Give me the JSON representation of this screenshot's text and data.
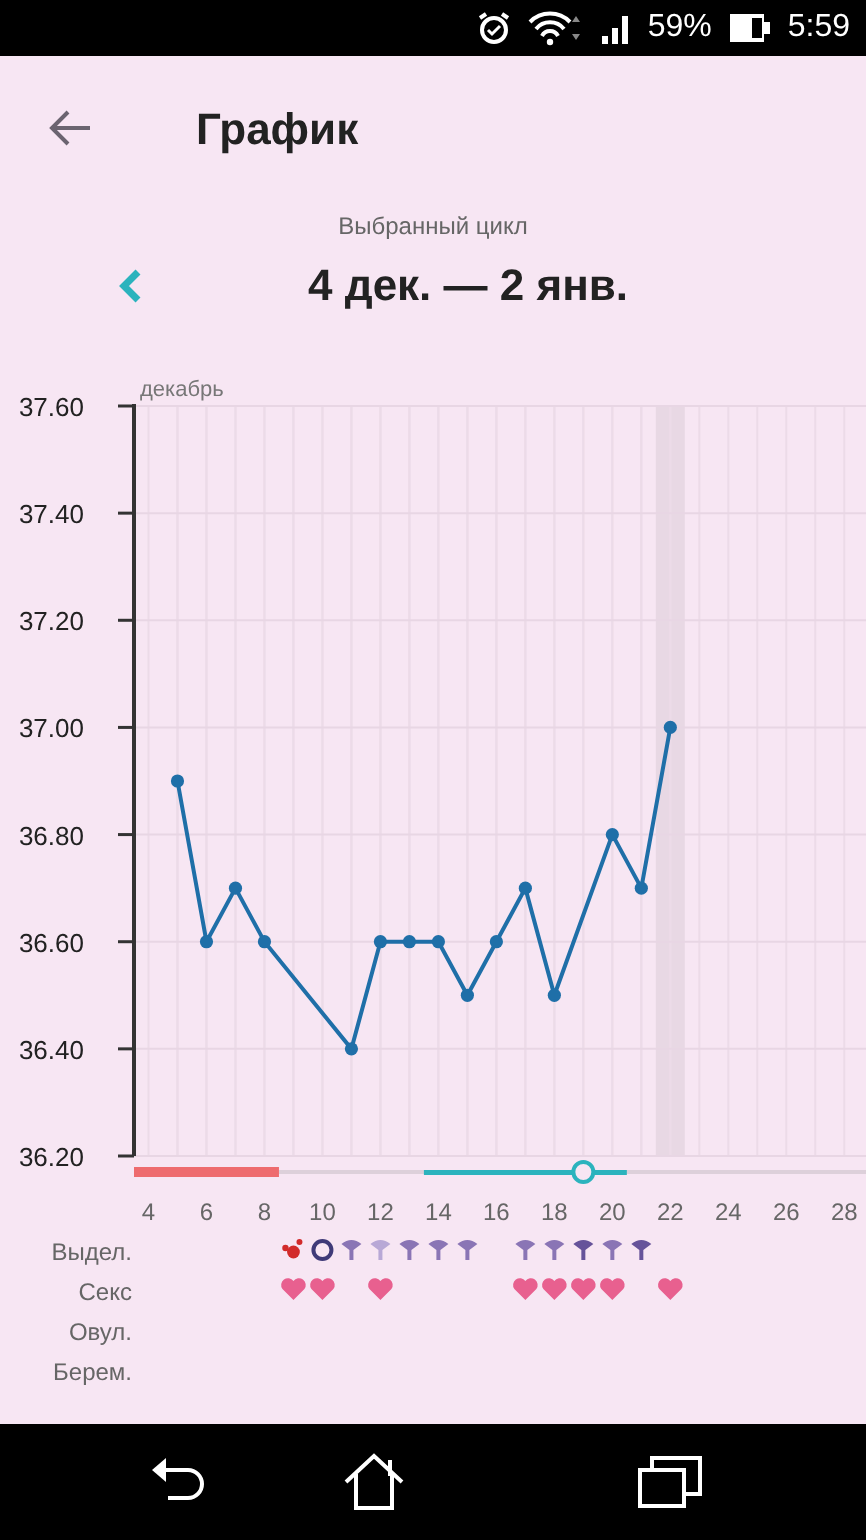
{
  "status_bar": {
    "battery": "59%",
    "time": "5:59"
  },
  "header": {
    "title": "График"
  },
  "cycle": {
    "caption": "Выбранный цикл",
    "range": "4 дек. — 2 янв."
  },
  "chart": {
    "month": "декабрь",
    "chart_data": {
      "type": "line",
      "x": [
        5,
        6,
        7,
        8,
        9,
        10,
        11,
        12,
        13,
        14,
        15,
        16,
        17,
        18,
        19,
        20,
        21,
        22
      ],
      "series": [
        {
          "color": "#1f6fa8",
          "marker": "circle",
          "values": [
            36.9,
            36.6,
            36.7,
            36.6,
            null,
            null,
            36.4,
            36.6,
            36.6,
            36.6,
            36.5,
            36.6,
            36.7,
            36.5,
            null,
            36.8,
            36.7,
            37.0
          ]
        }
      ],
      "xlim": [
        3.5,
        28.75
      ],
      "ylim": [
        36.2,
        37.6
      ],
      "grid": true,
      "xticks": [
        4,
        6,
        8,
        10,
        12,
        14,
        16,
        18,
        20,
        22,
        24,
        26,
        28
      ],
      "yticks": [
        {
          "value": 36.2,
          "label": "36.20"
        },
        {
          "value": 36.4,
          "label": "36.40"
        },
        {
          "value": 36.6,
          "label": "36.60"
        },
        {
          "value": 36.8,
          "label": "36.80"
        },
        {
          "value": 37.0,
          "label": "37.00"
        },
        {
          "value": 37.2,
          "label": "37.20"
        },
        {
          "value": 37.4,
          "label": "37.40"
        },
        {
          "value": 37.6,
          "label": "37.60"
        }
      ]
    },
    "phases": [
      {
        "kind": "period"
      },
      {
        "kind": "period"
      },
      {
        "kind": "period"
      },
      {
        "kind": "period"
      },
      {
        "kind": "none"
      },
      {
        "kind": "none"
      },
      {
        "kind": "none"
      },
      {
        "kind": "none"
      },
      {
        "kind": "none"
      },
      {
        "kind": "fertile"
      },
      {
        "kind": "fertile"
      },
      {
        "kind": "fertile"
      },
      {
        "kind": "fertile"
      },
      {
        "kind": "fertile"
      },
      {
        "kind": "ovulation"
      },
      {
        "kind": "fertile"
      },
      {
        "kind": "none"
      },
      {
        "kind": "current"
      }
    ]
  },
  "rows": [
    {
      "label": "Выдел.",
      "cells": [
        {
          "kind": "none"
        },
        {
          "kind": "none"
        },
        {
          "kind": "none"
        },
        {
          "kind": "none"
        },
        {
          "kind": "blood"
        },
        {
          "kind": "ring"
        },
        {
          "kind": "drop"
        },
        {
          "kind": "drop-light"
        },
        {
          "kind": "drop"
        },
        {
          "kind": "drop"
        },
        {
          "kind": "drop"
        },
        {
          "kind": "none"
        },
        {
          "kind": "drop"
        },
        {
          "kind": "drop"
        },
        {
          "kind": "drop-dark"
        },
        {
          "kind": "drop"
        },
        {
          "kind": "drop-dark"
        }
      ]
    },
    {
      "label": "Секс",
      "cells": [
        {
          "kind": "none"
        },
        {
          "kind": "none"
        },
        {
          "kind": "none"
        },
        {
          "kind": "none"
        },
        {
          "kind": "heart"
        },
        {
          "kind": "heart"
        },
        {
          "kind": "none"
        },
        {
          "kind": "heart"
        },
        {
          "kind": "none"
        },
        {
          "kind": "none"
        },
        {
          "kind": "none"
        },
        {
          "kind": "none"
        },
        {
          "kind": "heart"
        },
        {
          "kind": "heart"
        },
        {
          "kind": "heart"
        },
        {
          "kind": "heart"
        },
        {
          "kind": "none"
        },
        {
          "kind": "heart"
        }
      ]
    },
    {
      "label": "Овул."
    },
    {
      "label": "Берем."
    }
  ]
}
